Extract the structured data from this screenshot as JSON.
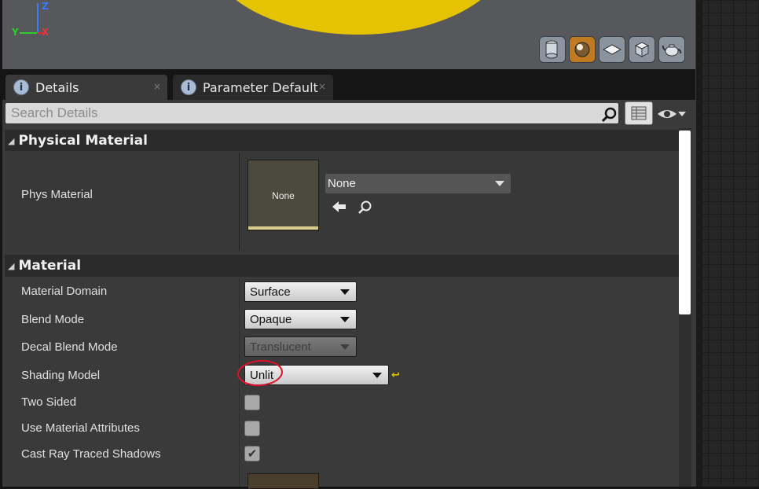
{
  "viewport": {
    "axes": {
      "z": "Z",
      "x": "X",
      "y": "Y"
    },
    "preview_buttons": [
      "cylinder-icon",
      "sphere-icon",
      "plane-icon",
      "cube-icon",
      "teapot-icon"
    ],
    "active_preview": "sphere-icon",
    "sphere_color": "#e6c300"
  },
  "tabs": [
    {
      "label": "Details",
      "close": "×",
      "active": true
    },
    {
      "label": "Parameter Default",
      "close": "×",
      "active": false
    }
  ],
  "search": {
    "placeholder": "Search Details",
    "value": ""
  },
  "sections": {
    "physical_material": {
      "title": "Physical Material",
      "phys_material": {
        "label": "Phys Material",
        "thumb_label": "None",
        "value": "None"
      }
    },
    "material": {
      "title": "Material",
      "rows": [
        {
          "label": "Material Domain",
          "value": "Surface"
        },
        {
          "label": "Blend Mode",
          "value": "Opaque"
        },
        {
          "label": "Decal Blend Mode",
          "value": "Translucent"
        },
        {
          "label": "Shading Model",
          "value": "Unlit"
        },
        {
          "label": "Two Sided",
          "checked": false
        },
        {
          "label": "Use Material Attributes",
          "checked": false
        },
        {
          "label": "Cast Ray Traced Shadows",
          "checked": true
        }
      ]
    }
  },
  "colors": {
    "annotation": "#e0102a",
    "reset_arrow": "#d9c400",
    "active_preview": "#c07a20"
  }
}
